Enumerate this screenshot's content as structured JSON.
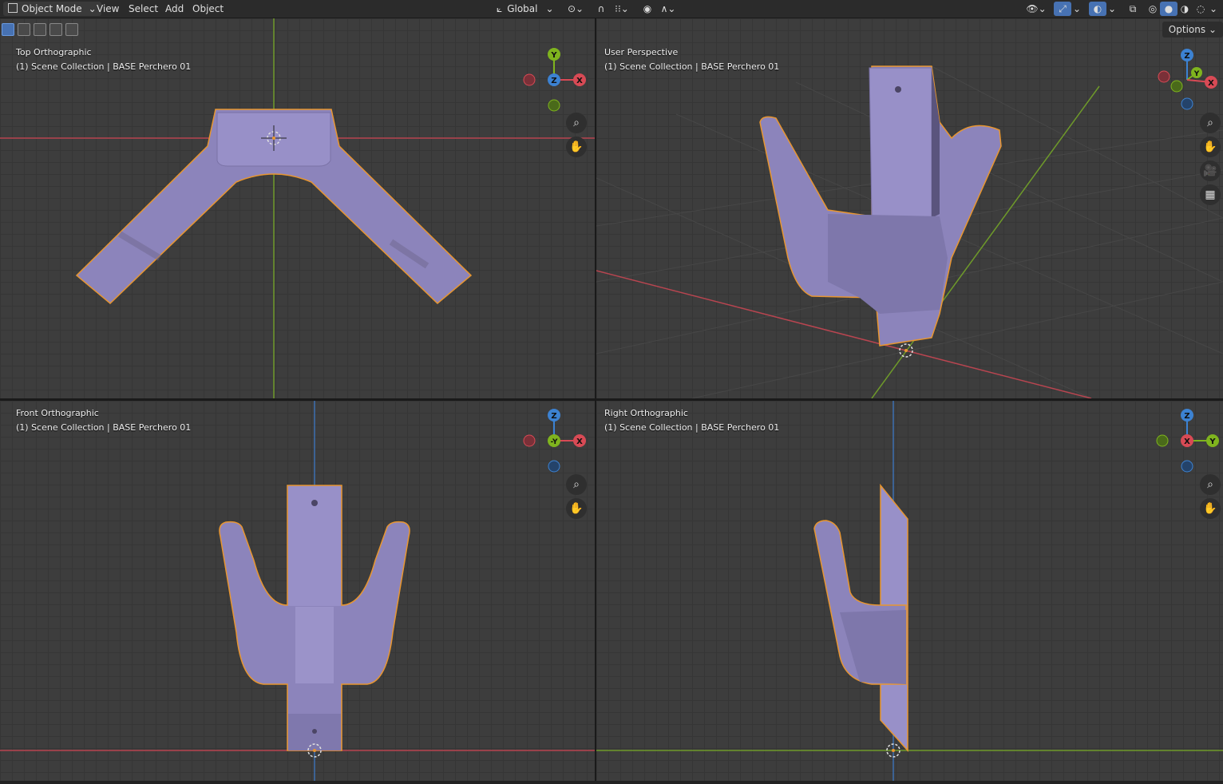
{
  "header": {
    "mode_label": "Object Mode",
    "menus": [
      "View",
      "Select",
      "Add",
      "Object"
    ],
    "transform_orientation": "Global",
    "options_label": "Options"
  },
  "viewports": [
    {
      "view": "Top Orthographic",
      "collection": "(1) Scene Collection | BASE Perchero 01",
      "gizmo": [
        "Y",
        "Z",
        "X"
      ]
    },
    {
      "view": "User Perspective",
      "collection": "(1) Scene Collection | BASE Perchero 01",
      "gizmo": [
        "Z",
        "Y",
        "X"
      ]
    },
    {
      "view": "Front Orthographic",
      "collection": "(1) Scene Collection | BASE Perchero 01",
      "gizmo": [
        "Z",
        "-Y",
        "X"
      ]
    },
    {
      "view": "Right Orthographic",
      "collection": "(1) Scene Collection | BASE Perchero 01",
      "gizmo": [
        "Z",
        "X",
        "Y"
      ]
    }
  ],
  "colors": {
    "axis_x": "#d84a55",
    "axis_y": "#7fb41e",
    "axis_z": "#3c82d2",
    "object_fill": "#8c84bb",
    "selection_outline": "#e89630",
    "viewport_bg": "#3d3d3d"
  },
  "icons": {
    "zoom": "zoom-icon",
    "pan": "hand-icon",
    "camera": "camera-icon",
    "perspective": "grid-perspective-icon"
  }
}
